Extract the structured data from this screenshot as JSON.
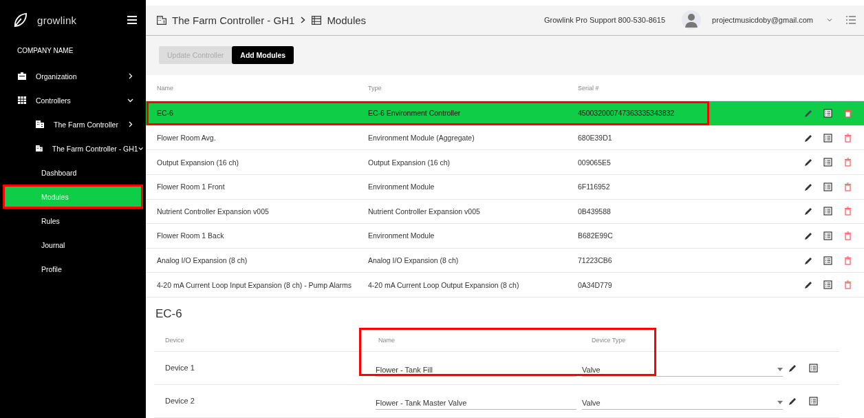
{
  "sidebar": {
    "brand": "growlink",
    "company": "COMPANY NAME",
    "items": [
      {
        "label": "Organization",
        "expanded": false,
        "selected": false,
        "annotated": false
      },
      {
        "label": "Controllers",
        "expanded": true,
        "selected": false,
        "annotated": false,
        "children": [
          {
            "label": "The Farm Controller",
            "expanded": false,
            "selected": false,
            "annotated": false
          },
          {
            "label": "The Farm Controller - GH1",
            "expanded": true,
            "selected": false,
            "annotated": false,
            "children": [
              {
                "label": "Dashboard",
                "selected": false,
                "annotated": false
              },
              {
                "label": "Modules",
                "selected": true,
                "annotated": true
              },
              {
                "label": "Rules",
                "selected": false,
                "annotated": false
              },
              {
                "label": "Journal",
                "selected": false,
                "annotated": false
              },
              {
                "label": "Profile",
                "selected": false,
                "annotated": false
              }
            ]
          }
        ]
      }
    ]
  },
  "header": {
    "breadcrumb": [
      "The Farm Controller - GH1",
      "Modules"
    ],
    "support": "Growlink Pro Support 800-530-8615",
    "user": "projectmusicdoby@gmail.com"
  },
  "toolbar": [
    {
      "label": "Update Controller",
      "disabled": true
    },
    {
      "label": "Add Modules",
      "disabled": false
    }
  ],
  "modules": {
    "columns": [
      "Name",
      "Type",
      "Serial #"
    ],
    "rows": [
      {
        "name": "EC-6",
        "type": "EC-6 Environment Controller",
        "serial": "450032000747363335343832",
        "selected": true,
        "annotated": true
      },
      {
        "name": "Flower Room Avg.",
        "type": "Environment Module (Aggregate)",
        "serial": "680E39D1",
        "selected": false,
        "annotated": false
      },
      {
        "name": "Output Expansion (16 ch)",
        "type": "Output Expansion (16 ch)",
        "serial": "009065E5",
        "selected": false,
        "annotated": false
      },
      {
        "name": "Flower Room 1 Front",
        "type": "Environment Module",
        "serial": "6F116952",
        "selected": false,
        "annotated": false
      },
      {
        "name": "Nutrient Controller Expansion v005",
        "type": "Nutrient Controller Expansion v005",
        "serial": "0B439588",
        "selected": false,
        "annotated": false
      },
      {
        "name": "Flower Room 1 Back",
        "type": "Environment Module",
        "serial": "B682E99C",
        "selected": false,
        "annotated": false
      },
      {
        "name": "Analog I/O Expansion (8 ch)",
        "type": "Analog I/O Expansion (8 ch)",
        "serial": "71223CB6",
        "selected": false,
        "annotated": false
      },
      {
        "name": "4-20 mA Current Loop Input Expansion (8 ch) - Pump Alarms",
        "type": "4-20 mA Current Loop Output Expansion (8 ch)",
        "serial": "0A34D779",
        "selected": false,
        "annotated": false
      }
    ]
  },
  "devices": {
    "title": "EC-6",
    "columns": [
      "Device",
      "Name",
      "Device Type"
    ],
    "annotated": true,
    "rows": [
      {
        "device": "Device 1",
        "name": "Flower - Tank Fill",
        "type": "Valve"
      },
      {
        "device": "Device 2",
        "name": "Flower - Tank Master Valve",
        "type": "Valve"
      }
    ]
  }
}
